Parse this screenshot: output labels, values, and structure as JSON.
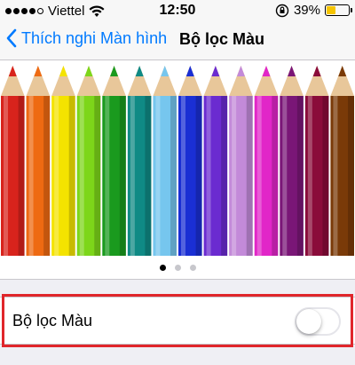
{
  "status_bar": {
    "carrier": "Viettel",
    "time": "12:50",
    "battery_percent": "39%",
    "signal_bars_filled": 4,
    "signal_bars_total": 5,
    "battery_level": 0.39,
    "icons": [
      "wifi-icon",
      "rotation-lock-icon",
      "battery-icon"
    ]
  },
  "nav": {
    "back_label": "Thích nghi Màn hình",
    "title": "Bộ lọc Màu"
  },
  "image": {
    "pencil_colors": [
      "#d8231c",
      "#ee6a12",
      "#f4e300",
      "#7dd61a",
      "#1a9a1e",
      "#0f8a85",
      "#76c6ee",
      "#1a2fd4",
      "#6b2bd0",
      "#c38ad9",
      "#e126c8",
      "#7a1677",
      "#8a0c3a",
      "#7a3a08"
    ]
  },
  "page_control": {
    "pages": 3,
    "current": 1
  },
  "settings": {
    "color_filter_label": "Bộ lọc Màu",
    "color_filter_on": false
  },
  "colors": {
    "accent": "#007aff",
    "highlight_border": "#e0262b",
    "background": "#efeff4"
  }
}
